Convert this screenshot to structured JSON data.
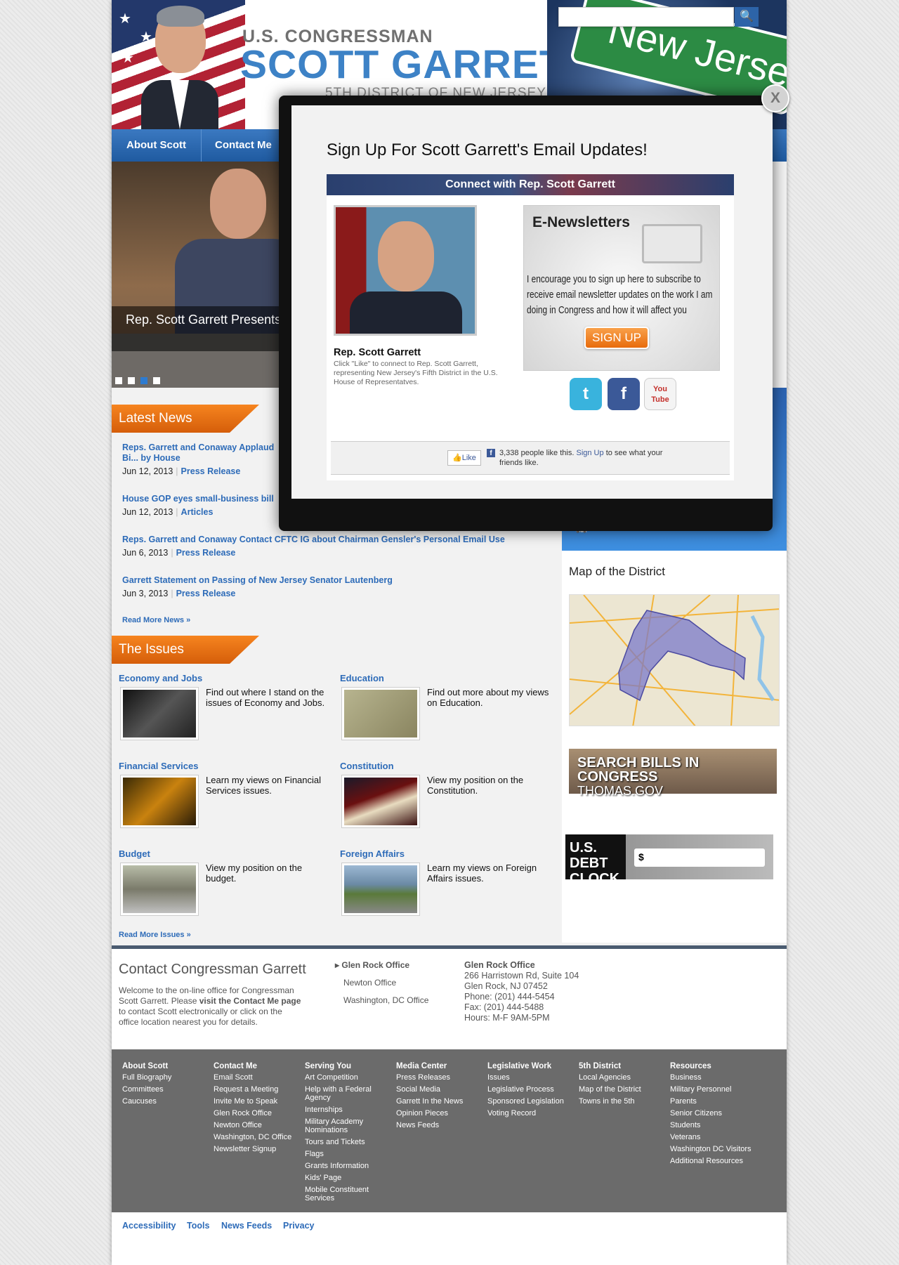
{
  "header": {
    "title_small": "U.S. CONGRESSMAN",
    "title_big": "SCOTT GARRETT",
    "title_sub": "5TH DISTRICT OF NEW JERSEY",
    "sign_text": "New Jersey",
    "search_placeholder": ""
  },
  "nav": [
    "About Scott",
    "Contact Me"
  ],
  "slider": {
    "caption": "Rep. Scott Garrett Presents Daughter",
    "dots": 4,
    "active_dot": 3
  },
  "latest_news": {
    "heading": "Latest News",
    "items": [
      {
        "title": "Reps. Garrett and Conaway Applaud Bi... by House",
        "date": "Jun 12, 2013",
        "category": "Press Release"
      },
      {
        "title": "House GOP eyes small-business bill",
        "date": "Jun 12, 2013",
        "category": "Articles"
      },
      {
        "title": "Reps. Garrett and Conaway Contact CFTC IG about Chairman Gensler's Personal Email Use",
        "date": "Jun 6, 2013",
        "category": "Press Release"
      },
      {
        "title": "Garrett Statement on Passing of New Jersey Senator Lautenberg",
        "date": "Jun 3, 2013",
        "category": "Press Release"
      }
    ],
    "read_more": "Read More News »"
  },
  "issues": {
    "heading": "The Issues",
    "items": [
      {
        "title": "Economy and Jobs",
        "text": "Find out where I stand on the issues of Economy and Jobs.",
        "color": "#2a2a2a"
      },
      {
        "title": "Education",
        "text": "Find out more about my views on Education.",
        "color": "#9a9470"
      },
      {
        "title": "Financial Services",
        "text": "Learn my views on Financial Services issues.",
        "color": "#2a1c08"
      },
      {
        "title": "Constitution",
        "text": "View my position on the Constitution.",
        "color": "#3a1010"
      },
      {
        "title": "Budget",
        "text": "View my position on the budget.",
        "color": "#8c8c7a"
      },
      {
        "title": "Foreign Affairs",
        "text": "Learn my views on Foreign Affairs issues.",
        "color": "#6b8aa5"
      }
    ],
    "read_more": "Read More Issues »"
  },
  "right": {
    "links": [
      "Military Academy Nominations",
      "Tours and Tickets"
    ],
    "map_title": "Map of the District",
    "bills_title": "SEARCH BILLS IN CONGRESS",
    "bills_sub": "THOMAS.GOV",
    "debt_label": "U.S. DEBT CLOCK",
    "debt_value": "$"
  },
  "contact": {
    "heading": "Contact Congressman Garrett",
    "intro_1": "Welcome to the on-line office for Congressman Scott Garrett. Please ",
    "intro_bold": "visit the Contact Me page",
    "intro_2": " to contact Scott electronically or click on the office location nearest you for details.",
    "offices": [
      "Glen Rock Office",
      "Newton Office",
      "Washington, DC Office"
    ],
    "address": {
      "name": "Glen Rock Office",
      "line1": "266 Harristown Rd, Suite 104",
      "line2": "Glen Rock, NJ 07452",
      "phone": "Phone: (201) 444-5454",
      "fax": "Fax: (201) 444-5488",
      "hours": "Hours: M-F 9AM-5PM"
    }
  },
  "footer": {
    "columns": [
      {
        "heading": "About Scott",
        "links": [
          "Full Biography",
          "Committees",
          "Caucuses"
        ]
      },
      {
        "heading": "Contact Me",
        "links": [
          "Email Scott",
          "Request a Meeting",
          "Invite Me to Speak",
          "Glen Rock Office",
          "Newton Office",
          "Washington, DC Office",
          "Newsletter Signup"
        ]
      },
      {
        "heading": "Serving You",
        "links": [
          "Art Competition",
          "Help with a Federal Agency",
          "Internships",
          "Military Academy Nominations",
          "Tours and Tickets",
          "Flags",
          "Grants Information",
          "Kids' Page",
          "Mobile Constituent Services"
        ]
      },
      {
        "heading": "Media Center",
        "links": [
          "Press Releases",
          "Social Media",
          "Garrett In the News",
          "Opinion Pieces",
          "News Feeds"
        ]
      },
      {
        "heading": "Legislative Work",
        "links": [
          "Issues",
          "Legislative Process",
          "Sponsored Legislation",
          "Voting Record"
        ]
      },
      {
        "heading": "5th District",
        "links": [
          "Local Agencies",
          "Map of the District",
          "Towns in the 5th"
        ]
      },
      {
        "heading": "Resources",
        "links": [
          "Business",
          "Military Personnel",
          "Parents",
          "Senior Citizens",
          "Students",
          "Veterans",
          "Washington DC Visitors",
          "Additional Resources"
        ]
      }
    ],
    "bottom_links": [
      "Accessibility",
      "Tools",
      "News Feeds",
      "Privacy"
    ]
  },
  "modal": {
    "close": "X",
    "title": "Sign Up For Scott Garrett's Email Updates!",
    "connect_bar": "Connect with Rep. Scott Garrett",
    "rep_name": "Rep. Scott Garrett",
    "rep_desc": "Click \"Like\" to connect to Rep. Scott Garrett, representing New Jersey's Fifth District in the U.S. House of Representatves.",
    "enews_title": "E-Newsletters",
    "enews_text": "I encourage you to sign up here to subscribe to receive email newsletter updates on the work I am doing in Congress and how it will affect you",
    "signup": "SIGN UP",
    "social": [
      {
        "name": "twitter",
        "glyph": "t",
        "color": "#39b3dd"
      },
      {
        "name": "facebook",
        "glyph": "f",
        "color": "#3b5998"
      },
      {
        "name": "youtube",
        "glyph": "You Tube",
        "color": "#f4f4f4"
      }
    ],
    "like_label": "Like",
    "fb_count": "3,338 people like this.",
    "fb_signup": "Sign Up",
    "fb_rest": "to see what your friends like."
  }
}
